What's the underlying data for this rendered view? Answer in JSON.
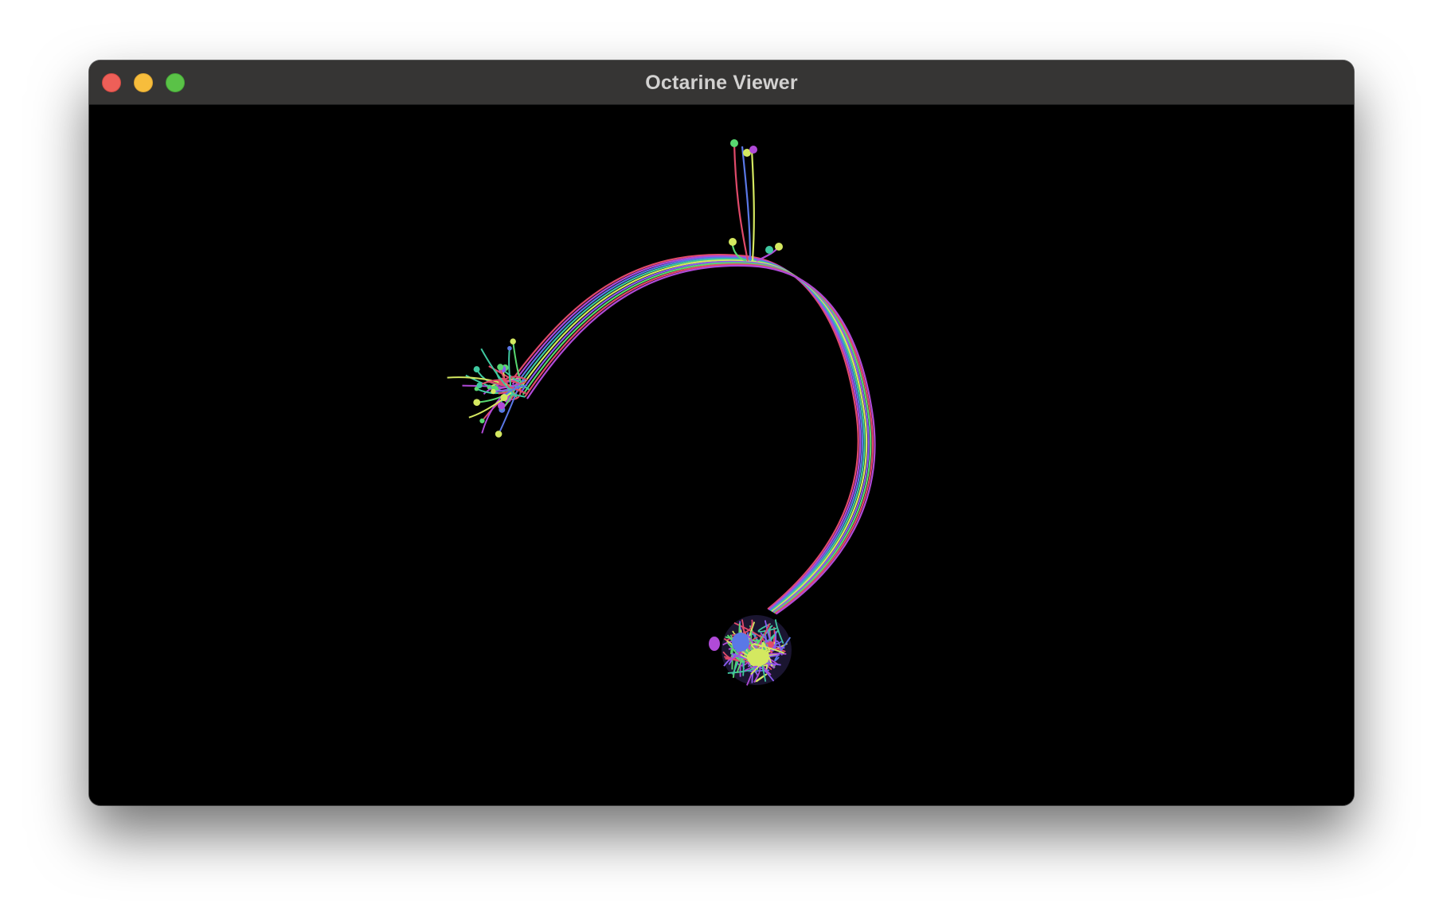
{
  "window": {
    "title": "Octarine Viewer"
  },
  "titlebar": {
    "buttons": [
      {
        "name": "close",
        "color": "#ee5f58"
      },
      {
        "name": "minimize",
        "color": "#f7bd3c"
      },
      {
        "name": "zoom",
        "color": "#5ac247"
      }
    ]
  },
  "viewport": {
    "background": "#000000",
    "content": "neuron-renderings",
    "palette": [
      "#e04a6a",
      "#b04ad8",
      "#5a78e6",
      "#3fc8a0",
      "#d4e860",
      "#8a5cf0",
      "#58d870"
    ]
  }
}
